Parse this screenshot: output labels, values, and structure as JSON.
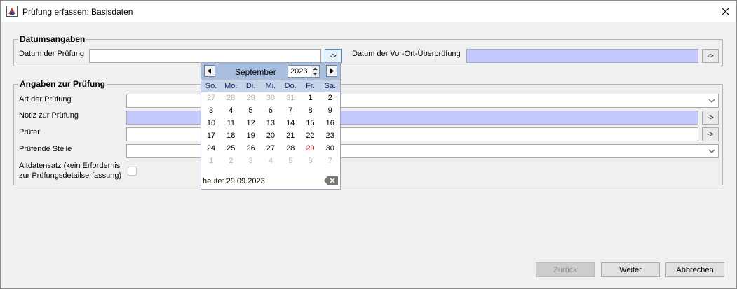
{
  "window": {
    "title": "Prüfung erfassen: Basisdaten"
  },
  "group_dates": {
    "title": "Datumsangaben",
    "date_label": "Datum der Prüfung",
    "date_value": "",
    "onsite_label": "Datum der Vor-Ort-Überprüfung",
    "onsite_value": "",
    "arrow_button": "->"
  },
  "group_details": {
    "title": "Angaben zur Prüfung",
    "type_label": "Art der Prüfung",
    "type_value": "",
    "note_label": "Notiz zur Prüfung",
    "note_value": "",
    "examiner_label": "Prüfer",
    "examiner_value": "",
    "office_label": "Prüfende Stelle",
    "office_value": "",
    "legacy_label_line1": "Altdatensatz (kein Erfordernis",
    "legacy_label_line2": "zur Prüfungsdetailserfassung)",
    "arrow_button": "->"
  },
  "calendar": {
    "month": "September",
    "year": "2023",
    "weekdays": [
      "So.",
      "Mo.",
      "Di.",
      "Mi.",
      "Do.",
      "Fr.",
      "Sa."
    ],
    "weeks": [
      [
        {
          "d": "27",
          "o": true
        },
        {
          "d": "28",
          "o": true
        },
        {
          "d": "29",
          "o": true
        },
        {
          "d": "30",
          "o": true
        },
        {
          "d": "31",
          "o": true
        },
        {
          "d": "1"
        },
        {
          "d": "2"
        }
      ],
      [
        {
          "d": "3"
        },
        {
          "d": "4"
        },
        {
          "d": "5"
        },
        {
          "d": "6"
        },
        {
          "d": "7"
        },
        {
          "d": "8"
        },
        {
          "d": "9"
        }
      ],
      [
        {
          "d": "10"
        },
        {
          "d": "11"
        },
        {
          "d": "12"
        },
        {
          "d": "13"
        },
        {
          "d": "14"
        },
        {
          "d": "15"
        },
        {
          "d": "16"
        }
      ],
      [
        {
          "d": "17"
        },
        {
          "d": "18"
        },
        {
          "d": "19"
        },
        {
          "d": "20"
        },
        {
          "d": "21"
        },
        {
          "d": "22"
        },
        {
          "d": "23"
        }
      ],
      [
        {
          "d": "24"
        },
        {
          "d": "25"
        },
        {
          "d": "26"
        },
        {
          "d": "27"
        },
        {
          "d": "28"
        },
        {
          "d": "29",
          "t": true
        },
        {
          "d": "30"
        }
      ],
      [
        {
          "d": "1",
          "o": true
        },
        {
          "d": "2",
          "o": true
        },
        {
          "d": "3",
          "o": true
        },
        {
          "d": "4",
          "o": true
        },
        {
          "d": "5",
          "o": true
        },
        {
          "d": "6",
          "o": true
        },
        {
          "d": "7",
          "o": true
        }
      ]
    ],
    "today_text": "heute: 29.09.2023"
  },
  "buttons": {
    "back": "Zurück",
    "next": "Weiter",
    "cancel": "Abbrechen"
  },
  "colors": {
    "highlight_field": "#c5c8fb",
    "calendar_header": "#a8bedf",
    "today": "#c82020"
  }
}
